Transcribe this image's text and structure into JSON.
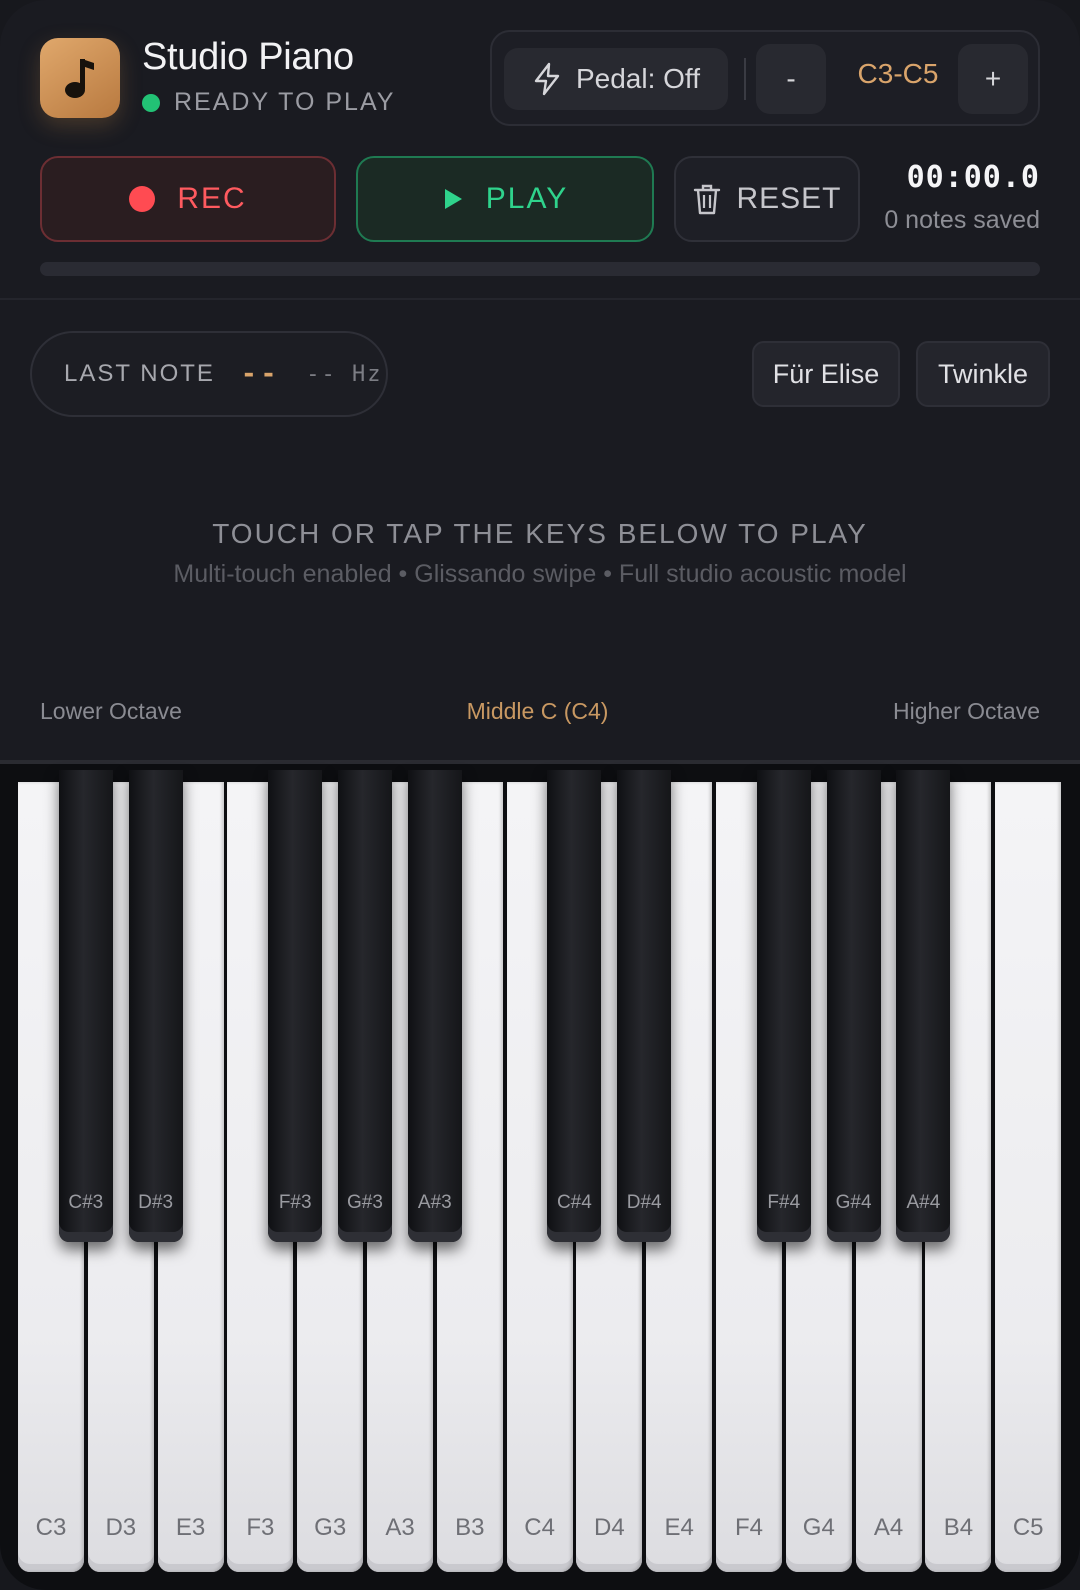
{
  "app": {
    "title": "Studio Piano",
    "status": "READY TO PLAY",
    "logo_icon": "music-note-icon",
    "accent_color": "#d9a46b"
  },
  "controls": {
    "pedal_label": "Pedal: Off",
    "decrease_label": "-",
    "range_label": "C3-C5",
    "increase_label": "+"
  },
  "transport": {
    "rec_label": "REC",
    "play_label": "PLAY",
    "reset_label": "RESET",
    "timer": "00:00.0",
    "notes_saved": "0 notes saved",
    "progress": 0
  },
  "info": {
    "last_note_label": "LAST NOTE",
    "last_note_value": "--",
    "last_note_hz": "-- Hz",
    "songs": [
      "Für Elise",
      "Twinkle"
    ]
  },
  "hint": {
    "title": "TOUCH OR TAP THE KEYS BELOW TO PLAY",
    "subtitle": "Multi-touch enabled • Glissando swipe • Full studio acoustic model"
  },
  "octave_labels": {
    "lower": "Lower Octave",
    "middle": "Middle C (C4)",
    "higher": "Higher Octave"
  },
  "keyboard": {
    "white_keys": [
      "C3",
      "D3",
      "E3",
      "F3",
      "G3",
      "A3",
      "B3",
      "C4",
      "D4",
      "E4",
      "F4",
      "G4",
      "A4",
      "B4",
      "C5"
    ],
    "black_keys": [
      "C#3",
      "D#3",
      "F#3",
      "G#3",
      "A#3",
      "C#4",
      "D#4",
      "F#4",
      "G#4",
      "A#4"
    ]
  }
}
